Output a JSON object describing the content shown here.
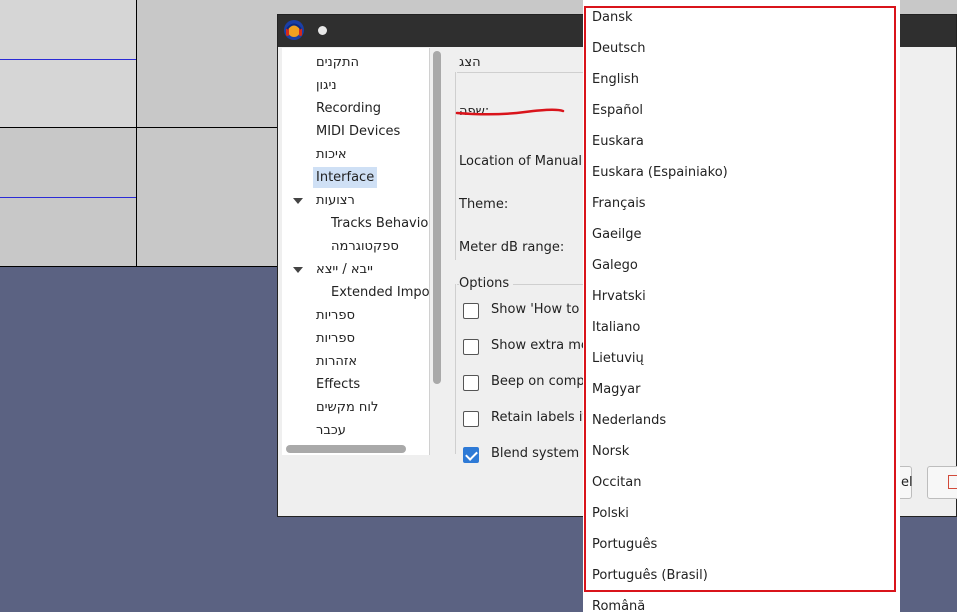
{
  "background": {
    "track_color": "#c8c8c8",
    "desktop_color": "#5b6282"
  },
  "dialog": {
    "tree": [
      {
        "label": "התקנים",
        "indent": 0,
        "expander": false,
        "selected": false
      },
      {
        "label": "ניגון",
        "indent": 0,
        "expander": false,
        "selected": false
      },
      {
        "label": "Recording",
        "indent": 0,
        "expander": false,
        "selected": false
      },
      {
        "label": "MIDI Devices",
        "indent": 0,
        "expander": false,
        "selected": false
      },
      {
        "label": "איכות",
        "indent": 0,
        "expander": false,
        "selected": false
      },
      {
        "label": "Interface",
        "indent": 0,
        "expander": false,
        "selected": true
      },
      {
        "label": "רצועות",
        "indent": 0,
        "expander": true,
        "selected": false
      },
      {
        "label": "Tracks Behavior",
        "indent": 1,
        "expander": false,
        "selected": false
      },
      {
        "label": "ספקטוגרמה",
        "indent": 1,
        "expander": false,
        "selected": false
      },
      {
        "label": "ייבא / ייצא",
        "indent": 0,
        "expander": true,
        "selected": false
      },
      {
        "label": "Extended Impor",
        "indent": 1,
        "expander": false,
        "selected": false
      },
      {
        "label": "ספריות",
        "indent": 0,
        "expander": false,
        "selected": false
      },
      {
        "label": "ספריות",
        "indent": 0,
        "expander": false,
        "selected": false
      },
      {
        "label": "אזהרות",
        "indent": 0,
        "expander": false,
        "selected": false
      },
      {
        "label": "Effects",
        "indent": 0,
        "expander": false,
        "selected": false
      },
      {
        "label": "לוח מקשים",
        "indent": 0,
        "expander": false,
        "selected": false
      },
      {
        "label": "עכבר",
        "indent": 0,
        "expander": false,
        "selected": false
      }
    ],
    "display_group": {
      "title": "הצג",
      "language_label": "שפה:",
      "manual_label": "Location of Manual:",
      "theme_label": "Theme:",
      "meter_label": "Meter dB range:"
    },
    "options_group": {
      "title": "Options",
      "checkboxes": [
        {
          "label": "Show 'How to G",
          "checked": false
        },
        {
          "label": "Show extra mer",
          "checked": false
        },
        {
          "label": "Beep on compl",
          "checked": false
        },
        {
          "label": "Retain labels if",
          "checked": false
        },
        {
          "label": "Blend system a",
          "checked": true
        }
      ]
    },
    "ok_partial": "el"
  },
  "language_dropdown": {
    "options": [
      "Dansk",
      "Deutsch",
      "English",
      "Español",
      "Euskara",
      "Euskara (Espainiako)",
      "Français",
      "Gaeilge",
      "Galego",
      "Hrvatski",
      "Italiano",
      "Lietuvių",
      "Magyar",
      "Nederlands",
      "Norsk",
      "Occitan",
      "Polski",
      "Português",
      "Português (Brasil)",
      "Română"
    ],
    "highlight_color": "#d9141b"
  }
}
